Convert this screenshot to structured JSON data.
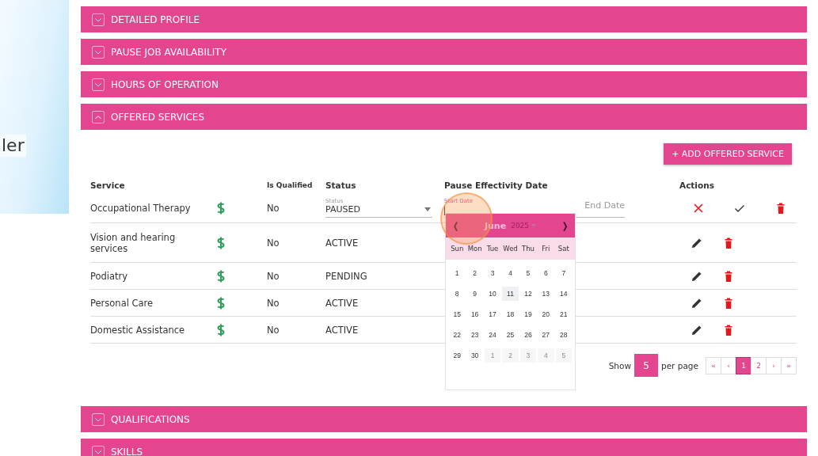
{
  "left_panel": {
    "text": "ler"
  },
  "sections": [
    {
      "title": "DETAILED PROFILE",
      "expanded": false
    },
    {
      "title": "PAUSE JOB AVAILABILITY",
      "expanded": false
    },
    {
      "title": "HOURS OF OPERATION",
      "expanded": false
    },
    {
      "title": "OFFERED SERVICES",
      "expanded": true
    },
    {
      "title": "QUALIFICATIONS",
      "expanded": false
    },
    {
      "title": "SKILLS",
      "expanded": false
    }
  ],
  "offered_services": {
    "add_button": "+ ADD OFFERED SERVICE",
    "columns": [
      "Service",
      "Is Qualified",
      "Status",
      "Pause Effectivity Date",
      "Actions"
    ],
    "rows": [
      {
        "kind": "editing",
        "service": "Occupational Therapy",
        "is_qualified": "No",
        "status_label": "Status",
        "status": "PAUSED",
        "start_label": "Start Date",
        "end_placeholder": "End Date"
      },
      {
        "kind": "view",
        "service": "Vision and hearing services",
        "is_qualified": "No",
        "status": "ACTIVE"
      },
      {
        "kind": "view",
        "service": "Podiatry",
        "is_qualified": "No",
        "status": "PENDING"
      },
      {
        "kind": "view",
        "service": "Personal Care",
        "is_qualified": "No",
        "status": "ACTIVE"
      },
      {
        "kind": "view",
        "service": "Domestic Assistance",
        "is_qualified": "No",
        "status": "ACTIVE"
      }
    ],
    "pagination": {
      "show": "Show",
      "page_size": "5",
      "per_page": "per page",
      "buttons": [
        {
          "label": "«",
          "selected": false
        },
        {
          "label": "‹",
          "selected": false
        },
        {
          "label": "1",
          "selected": true
        },
        {
          "label": "2",
          "selected": false
        },
        {
          "label": "›",
          "selected": false
        },
        {
          "label": "»",
          "selected": false
        }
      ]
    }
  },
  "datepicker": {
    "prev": "❬",
    "month": "June",
    "year": "2025",
    "next": "❭",
    "weekdays": [
      "Sun",
      "Mon",
      "Tue",
      "Wed",
      "Thu",
      "Fri",
      "Sat"
    ],
    "days": [
      {
        "label": "1",
        "outside": false,
        "today": false
      },
      {
        "label": "2",
        "outside": false,
        "today": false
      },
      {
        "label": "3",
        "outside": false,
        "today": false
      },
      {
        "label": "4",
        "outside": false,
        "today": false
      },
      {
        "label": "5",
        "outside": false,
        "today": false
      },
      {
        "label": "6",
        "outside": false,
        "today": false
      },
      {
        "label": "7",
        "outside": false,
        "today": false
      },
      {
        "label": "8",
        "outside": false,
        "today": false
      },
      {
        "label": "9",
        "outside": false,
        "today": false
      },
      {
        "label": "10",
        "outside": false,
        "today": false
      },
      {
        "label": "11",
        "outside": false,
        "today": true
      },
      {
        "label": "12",
        "outside": false,
        "today": false
      },
      {
        "label": "13",
        "outside": false,
        "today": false
      },
      {
        "label": "14",
        "outside": false,
        "today": false
      },
      {
        "label": "15",
        "outside": false,
        "today": false
      },
      {
        "label": "16",
        "outside": false,
        "today": false
      },
      {
        "label": "17",
        "outside": false,
        "today": false
      },
      {
        "label": "18",
        "outside": false,
        "today": false
      },
      {
        "label": "19",
        "outside": false,
        "today": false
      },
      {
        "label": "20",
        "outside": false,
        "today": false
      },
      {
        "label": "21",
        "outside": false,
        "today": false
      },
      {
        "label": "22",
        "outside": false,
        "today": false
      },
      {
        "label": "23",
        "outside": false,
        "today": false
      },
      {
        "label": "24",
        "outside": false,
        "today": false
      },
      {
        "label": "25",
        "outside": false,
        "today": false
      },
      {
        "label": "26",
        "outside": false,
        "today": false
      },
      {
        "label": "27",
        "outside": false,
        "today": false
      },
      {
        "label": "28",
        "outside": false,
        "today": false
      },
      {
        "label": "29",
        "outside": false,
        "today": false
      },
      {
        "label": "30",
        "outside": false,
        "today": false
      },
      {
        "label": "1",
        "outside": true,
        "today": false
      },
      {
        "label": "2",
        "outside": true,
        "today": false
      },
      {
        "label": "3",
        "outside": true,
        "today": false
      },
      {
        "label": "4",
        "outside": true,
        "today": false
      },
      {
        "label": "5",
        "outside": true,
        "today": false
      }
    ]
  }
}
